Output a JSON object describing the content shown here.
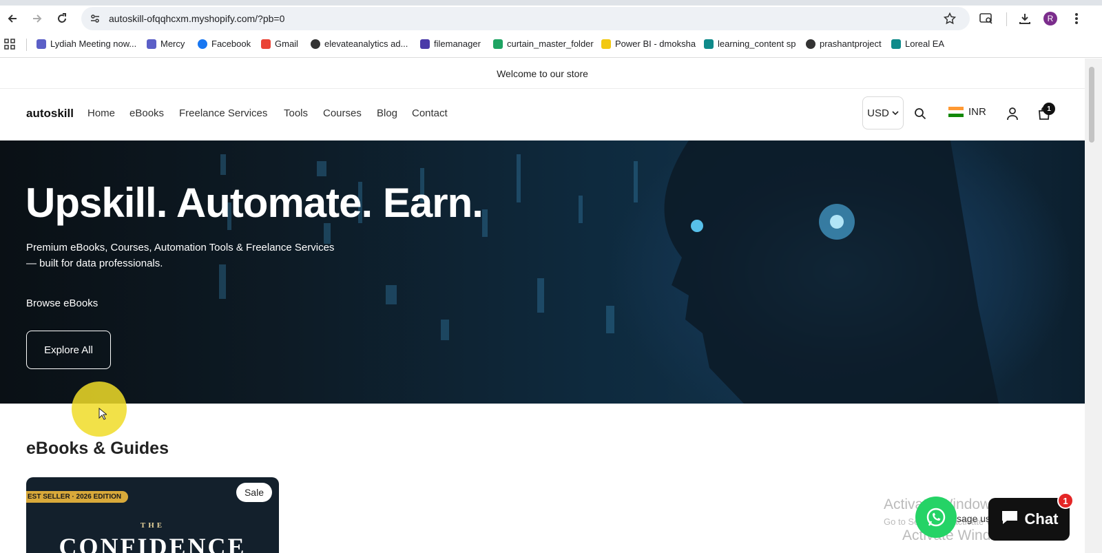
{
  "browser": {
    "url": "autoskill-ofqqhcxm.myshopify.com/?pb=0",
    "profile_initial": "R",
    "bookmarks": [
      {
        "label": "Lydiah Meeting now...",
        "color": "#5b5fc7"
      },
      {
        "label": "Mercy",
        "color": "#5b5fc7"
      },
      {
        "label": "Facebook",
        "color": "#1877f2"
      },
      {
        "label": "Gmail",
        "color": "#ea4335"
      },
      {
        "label": "elevateanalytics ad...",
        "color": "#333333"
      },
      {
        "label": "filemanager",
        "color": "#4a3aa8"
      },
      {
        "label": "curtain_master_folder",
        "color": "#1fa463"
      },
      {
        "label": "Power BI - dmoksha",
        "color": "#f2c811"
      },
      {
        "label": "learning_content sp",
        "color": "#0f8a8a"
      },
      {
        "label": "prashantproject",
        "color": "#333333"
      },
      {
        "label": "Loreal EA",
        "color": "#0f8a8a"
      }
    ]
  },
  "store": {
    "announcement": "Welcome to our store",
    "logo": "autoskill",
    "nav": [
      "Home",
      "eBooks",
      "Freelance Services",
      "Tools",
      "Courses",
      "Blog",
      "Contact"
    ],
    "currency": "USD",
    "country_currency": "INR",
    "cart_count": "1"
  },
  "hero": {
    "title": "Upskill. Automate. Earn.",
    "subtitle_line1": "Premium eBooks, Courses, Automation Tools & Freelance Services",
    "subtitle_line2": "— built for data professionals.",
    "browse_label": "Browse eBooks",
    "button_label": "Explore All"
  },
  "section": {
    "title": "eBooks & Guides",
    "product": {
      "ribbon": "EST SELLER · 2026 EDITION",
      "badge": "Sale",
      "cover_the": "THE",
      "cover_title": "CONFIDENCE"
    }
  },
  "overlay": {
    "watermark_1": "Activate Windows",
    "watermark_2": "Go to Settings to activate Windows.",
    "message_fragment": "ssage us",
    "chat_label": "Chat",
    "chat_badge": "1"
  }
}
